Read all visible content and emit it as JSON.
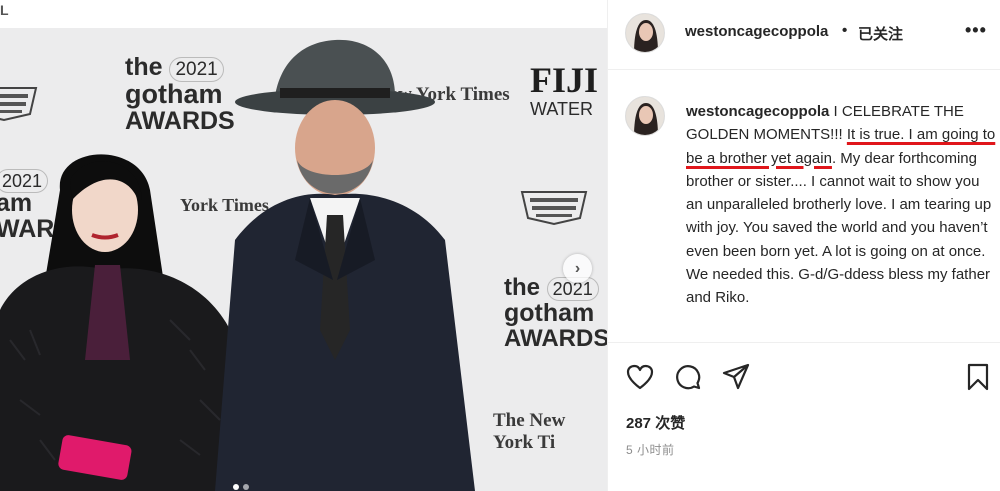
{
  "photo": {
    "corner_fragment": "L",
    "backdrop": {
      "gotham_the": "the",
      "gotham_year": "2021",
      "gotham_name": "gotham",
      "gotham_awards": "AWARDS",
      "left_year": "2021",
      "left_name": "am",
      "left_awards": "WARDS",
      "nyt_top": "New York Times",
      "nyt_mid": "York Times",
      "nyt_bottom": "The New York Ti",
      "fiji": "FIJI",
      "fiji_sub": "WATER"
    },
    "carousel_next_icon": "chevron-right-icon",
    "slide_dots": [
      true,
      false
    ]
  },
  "post": {
    "header": {
      "username": "westoncagecoppola",
      "separator": "•",
      "follow_label": "已关注",
      "more_icon": "more-horizontal-icon",
      "more_text": "•••"
    },
    "caption": {
      "username": "westoncagecoppola",
      "part1": " I CELEBRATE THE GOLDEN MOMENTS!!! ",
      "underline1": "It is true. I am going to be a brother yet again",
      "part2": ". My dear forthcoming brother or sister.... I cannot wait to show you an unparalleled brotherly love. I am tearing up with joy. You saved the world and you haven’t even been born yet. A lot is going on at once. We needed this. G-d/G-ddess bless my father and Riko.",
      "underline_color": "#e0161b"
    },
    "actions": {
      "like_icon": "heart-icon",
      "comment_icon": "comment-icon",
      "share_icon": "send-icon",
      "save_icon": "bookmark-icon"
    },
    "likes": "287 次赞",
    "timestamp": "5 小时前"
  }
}
